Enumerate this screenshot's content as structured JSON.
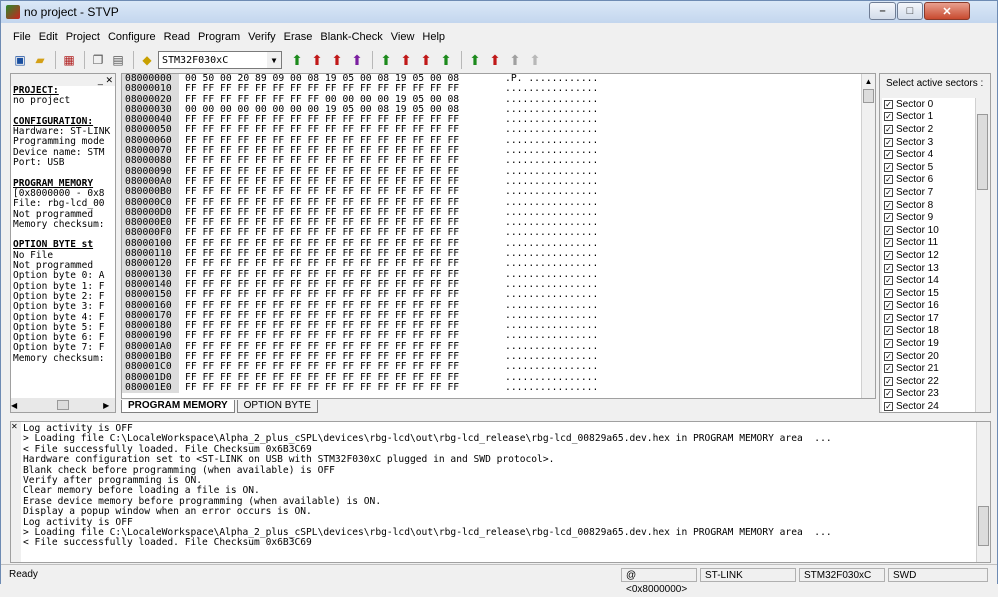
{
  "window": {
    "title": "no project - STVP",
    "min": "–",
    "max": "□",
    "close": "✕"
  },
  "menu": [
    "File",
    "Edit",
    "Project",
    "Configure",
    "Read",
    "Program",
    "Verify",
    "Erase",
    "Blank-Check",
    "View",
    "Help"
  ],
  "toolbar": {
    "device": "STM32F030xC",
    "icons": [
      "save-icon",
      "open-icon",
      "chip-icon",
      "copy-icon",
      "paste-icon",
      "device-icon"
    ]
  },
  "left_panel": {
    "lines": [
      {
        "text": "PROJECT:",
        "head": true
      },
      {
        "text": "no project"
      },
      {
        "text": ""
      },
      {
        "text": "CONFIGURATION:",
        "head": true
      },
      {
        "text": "Hardware: ST-LINK"
      },
      {
        "text": "Programming mode"
      },
      {
        "text": "Device name: STM"
      },
      {
        "text": "Port: USB"
      },
      {
        "text": ""
      },
      {
        "text": "PROGRAM MEMORY",
        "head": true
      },
      {
        "text": "[0x8000000 - 0x8"
      },
      {
        "text": "File: rbg-lcd_00"
      },
      {
        "text": "Not programmed"
      },
      {
        "text": "Memory checksum:"
      },
      {
        "text": ""
      },
      {
        "text": "OPTION BYTE st",
        "head": true
      },
      {
        "text": "No File"
      },
      {
        "text": "Not programmed"
      },
      {
        "text": "Option byte 0: A"
      },
      {
        "text": "Option byte 1: F"
      },
      {
        "text": "Option byte 2: F"
      },
      {
        "text": "Option byte 3: F"
      },
      {
        "text": "Option byte 4: F"
      },
      {
        "text": "Option byte 5: F"
      },
      {
        "text": "Option byte 6: F"
      },
      {
        "text": "Option byte 7: F"
      },
      {
        "text": "Memory checksum:"
      }
    ]
  },
  "hex": {
    "rows": [
      {
        "addr": "08000000",
        "bytes": "00 50 00 20 89 09 00 08 19 05 00 08 19 05 00 08",
        "ascii": ".P. ............"
      },
      {
        "addr": "08000010",
        "bytes": "FF FF FF FF FF FF FF FF FF FF FF FF FF FF FF FF",
        "ascii": "................"
      },
      {
        "addr": "08000020",
        "bytes": "FF FF FF FF FF FF FF FF 00 00 00 00 19 05 00 08",
        "ascii": "................"
      },
      {
        "addr": "08000030",
        "bytes": "00 00 00 00 00 00 00 00 19 05 00 08 19 05 00 08",
        "ascii": "................"
      },
      {
        "addr": "08000040",
        "bytes": "FF FF FF FF FF FF FF FF FF FF FF FF FF FF FF FF",
        "ascii": "................"
      },
      {
        "addr": "08000050",
        "bytes": "FF FF FF FF FF FF FF FF FF FF FF FF FF FF FF FF",
        "ascii": "................"
      },
      {
        "addr": "08000060",
        "bytes": "FF FF FF FF FF FF FF FF FF FF FF FF FF FF FF FF",
        "ascii": "................"
      },
      {
        "addr": "08000070",
        "bytes": "FF FF FF FF FF FF FF FF FF FF FF FF FF FF FF FF",
        "ascii": "................"
      },
      {
        "addr": "08000080",
        "bytes": "FF FF FF FF FF FF FF FF FF FF FF FF FF FF FF FF",
        "ascii": "................"
      },
      {
        "addr": "08000090",
        "bytes": "FF FF FF FF FF FF FF FF FF FF FF FF FF FF FF FF",
        "ascii": "................"
      },
      {
        "addr": "080000A0",
        "bytes": "FF FF FF FF FF FF FF FF FF FF FF FF FF FF FF FF",
        "ascii": "................"
      },
      {
        "addr": "080000B0",
        "bytes": "FF FF FF FF FF FF FF FF FF FF FF FF FF FF FF FF",
        "ascii": "................"
      },
      {
        "addr": "080000C0",
        "bytes": "FF FF FF FF FF FF FF FF FF FF FF FF FF FF FF FF",
        "ascii": "................"
      },
      {
        "addr": "080000D0",
        "bytes": "FF FF FF FF FF FF FF FF FF FF FF FF FF FF FF FF",
        "ascii": "................"
      },
      {
        "addr": "080000E0",
        "bytes": "FF FF FF FF FF FF FF FF FF FF FF FF FF FF FF FF",
        "ascii": "................"
      },
      {
        "addr": "080000F0",
        "bytes": "FF FF FF FF FF FF FF FF FF FF FF FF FF FF FF FF",
        "ascii": "................"
      },
      {
        "addr": "08000100",
        "bytes": "FF FF FF FF FF FF FF FF FF FF FF FF FF FF FF FF",
        "ascii": "................"
      },
      {
        "addr": "08000110",
        "bytes": "FF FF FF FF FF FF FF FF FF FF FF FF FF FF FF FF",
        "ascii": "................"
      },
      {
        "addr": "08000120",
        "bytes": "FF FF FF FF FF FF FF FF FF FF FF FF FF FF FF FF",
        "ascii": "................"
      },
      {
        "addr": "08000130",
        "bytes": "FF FF FF FF FF FF FF FF FF FF FF FF FF FF FF FF",
        "ascii": "................"
      },
      {
        "addr": "08000140",
        "bytes": "FF FF FF FF FF FF FF FF FF FF FF FF FF FF FF FF",
        "ascii": "................"
      },
      {
        "addr": "08000150",
        "bytes": "FF FF FF FF FF FF FF FF FF FF FF FF FF FF FF FF",
        "ascii": "................"
      },
      {
        "addr": "08000160",
        "bytes": "FF FF FF FF FF FF FF FF FF FF FF FF FF FF FF FF",
        "ascii": "................"
      },
      {
        "addr": "08000170",
        "bytes": "FF FF FF FF FF FF FF FF FF FF FF FF FF FF FF FF",
        "ascii": "................"
      },
      {
        "addr": "08000180",
        "bytes": "FF FF FF FF FF FF FF FF FF FF FF FF FF FF FF FF",
        "ascii": "................"
      },
      {
        "addr": "08000190",
        "bytes": "FF FF FF FF FF FF FF FF FF FF FF FF FF FF FF FF",
        "ascii": "................"
      },
      {
        "addr": "080001A0",
        "bytes": "FF FF FF FF FF FF FF FF FF FF FF FF FF FF FF FF",
        "ascii": "................"
      },
      {
        "addr": "080001B0",
        "bytes": "FF FF FF FF FF FF FF FF FF FF FF FF FF FF FF FF",
        "ascii": "................"
      },
      {
        "addr": "080001C0",
        "bytes": "FF FF FF FF FF FF FF FF FF FF FF FF FF FF FF FF",
        "ascii": "................"
      },
      {
        "addr": "080001D0",
        "bytes": "FF FF FF FF FF FF FF FF FF FF FF FF FF FF FF FF",
        "ascii": "................"
      },
      {
        "addr": "080001E0",
        "bytes": "FF FF FF FF FF FF FF FF FF FF FF FF FF FF FF FF",
        "ascii": "................"
      }
    ]
  },
  "tabs": [
    "PROGRAM MEMORY",
    "OPTION BYTE"
  ],
  "sectors": {
    "title": "Select active sectors :",
    "items": [
      "Sector 0",
      "Sector 1",
      "Sector 2",
      "Sector 3",
      "Sector 4",
      "Sector 5",
      "Sector 6",
      "Sector 7",
      "Sector 8",
      "Sector 9",
      "Sector 10",
      "Sector 11",
      "Sector 12",
      "Sector 13",
      "Sector 14",
      "Sector 15",
      "Sector 16",
      "Sector 17",
      "Sector 18",
      "Sector 19",
      "Sector 20",
      "Sector 21",
      "Sector 22",
      "Sector 23",
      "Sector 24"
    ]
  },
  "log": [
    "Log activity is OFF",
    "> Loading file C:\\LocaleWorkspace\\Alpha_2_plus_cSPL\\devices\\rbg-lcd\\out\\rbg-lcd_release\\rbg-lcd_00829a65.dev.hex in PROGRAM MEMORY area  ...",
    "< File successfully loaded. File Checksum 0x6B3C69",
    "Hardware configuration set to <ST-LINK on USB with STM32F030xC plugged in and SWD protocol>.",
    "Blank check before programming (when available) is OFF",
    "Verify after programming is ON.",
    "Clear memory before loading a file is ON.",
    "Erase device memory before programming (when available) is ON.",
    "Display a popup window when an error occurs is ON.",
    "Log activity is OFF",
    "> Loading file C:\\LocaleWorkspace\\Alpha_2_plus_cSPL\\devices\\rbg-lcd\\out\\rbg-lcd_release\\rbg-lcd_00829a65.dev.hex in PROGRAM MEMORY area  ...",
    "< File successfully loaded. File Checksum 0x6B3C69"
  ],
  "status": {
    "ready": "Ready",
    "address": "@ <0x8000000>",
    "hardware": "ST-LINK",
    "device": "STM32F030xC",
    "protocol": "SWD"
  }
}
